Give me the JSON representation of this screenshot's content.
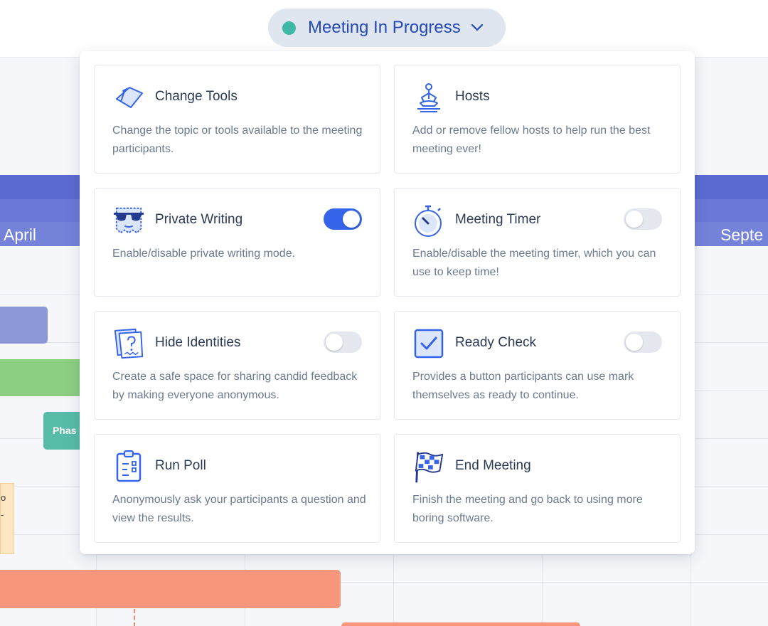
{
  "status": {
    "label": "Meeting In Progress",
    "dot_color": "#3eb8a4",
    "icon": "chevron-down-icon"
  },
  "background": {
    "months": [
      "April",
      "Septe"
    ],
    "phase_bar_label": "Phas",
    "sticky_text": [
      "o",
      "-"
    ]
  },
  "tools": [
    {
      "title": "Change Tools",
      "description": "Change the topic or tools available to the meeting participants.",
      "icon": "change-tools-icon"
    },
    {
      "title": "Hosts",
      "description": "Add or remove fellow hosts to help run the best meeting ever!",
      "icon": "hosts-meditation-icon"
    },
    {
      "title": "Private Writing",
      "description": "Enable/disable private writing mode.",
      "icon": "sunglasses-icon",
      "toggle": true,
      "enabled": true
    },
    {
      "title": "Meeting Timer",
      "description": "Enable/disable the meeting timer, which you can use to keep time!",
      "icon": "stopwatch-icon",
      "toggle": true,
      "enabled": false
    },
    {
      "title": "Hide Identities",
      "description": "Create a safe space for sharing candid feedback by making everyone anonymous.",
      "icon": "anonymous-note-icon",
      "toggle": true,
      "enabled": false
    },
    {
      "title": "Ready Check",
      "description": "Provides a button participants can use mark themselves as ready to continue.",
      "icon": "checkbox-icon",
      "toggle": true,
      "enabled": false
    },
    {
      "title": "Run Poll",
      "description": "Anonymously ask your participants a question and view the results.",
      "icon": "clipboard-poll-icon"
    },
    {
      "title": "End Meeting",
      "description": "Finish the meeting and go back to using more boring software.",
      "icon": "checkered-flag-icon"
    }
  ],
  "colors": {
    "accent": "#3563e9",
    "title_text": "#2b3a55",
    "desc_text": "#6b7a90",
    "band": "#6b78d8"
  }
}
